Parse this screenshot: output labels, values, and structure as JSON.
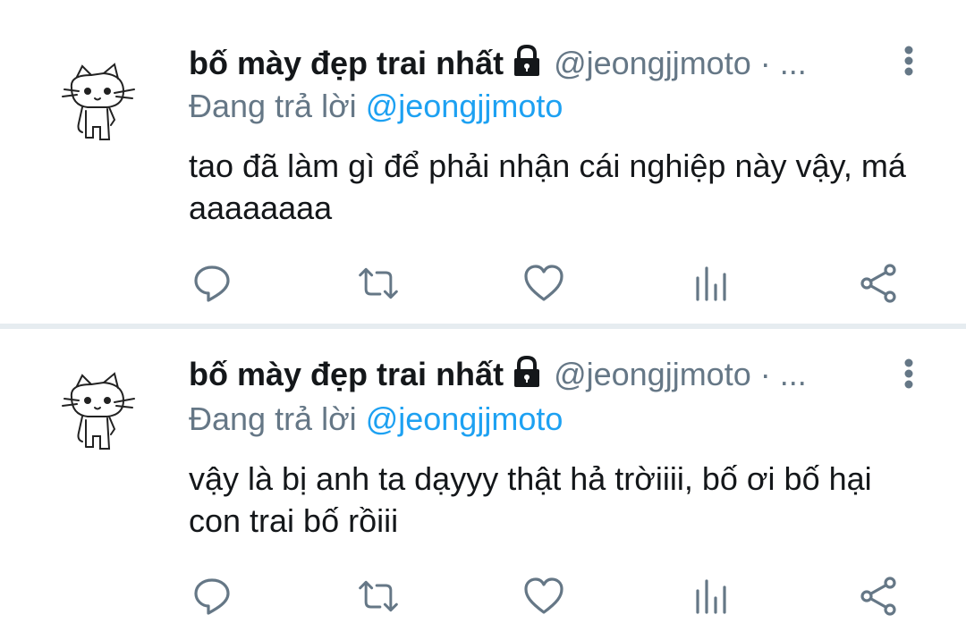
{
  "tweets": [
    {
      "display_name": "bố mày đẹp trai nhất",
      "handle": "@jeongjjmoto · ...",
      "replying_prefix": "Đang trả lời",
      "replying_to": "@jeongjjmoto",
      "text": "tao đã làm gì để phải nhận cái nghiệp này vậy, má aaaaaaaa"
    },
    {
      "display_name": "bố mày đẹp trai nhất",
      "handle": "@jeongjjmoto · ...",
      "replying_prefix": "Đang trả lời",
      "replying_to": "@jeongjjmoto",
      "text": "vậy là bị anh ta dạyyy thật hả trờiiii, bố ơi bố hại con trai bố rồiii"
    }
  ],
  "icons": {
    "lock": "lock-icon",
    "more": "more-vertical-icon",
    "reply": "reply-icon",
    "retweet": "retweet-icon",
    "like": "heart-icon",
    "analytics": "analytics-icon",
    "share": "share-icon"
  },
  "colors": {
    "text": "#14171a",
    "secondary": "#657786",
    "mention": "#1da1f2",
    "separator": "#e6ecf0"
  }
}
